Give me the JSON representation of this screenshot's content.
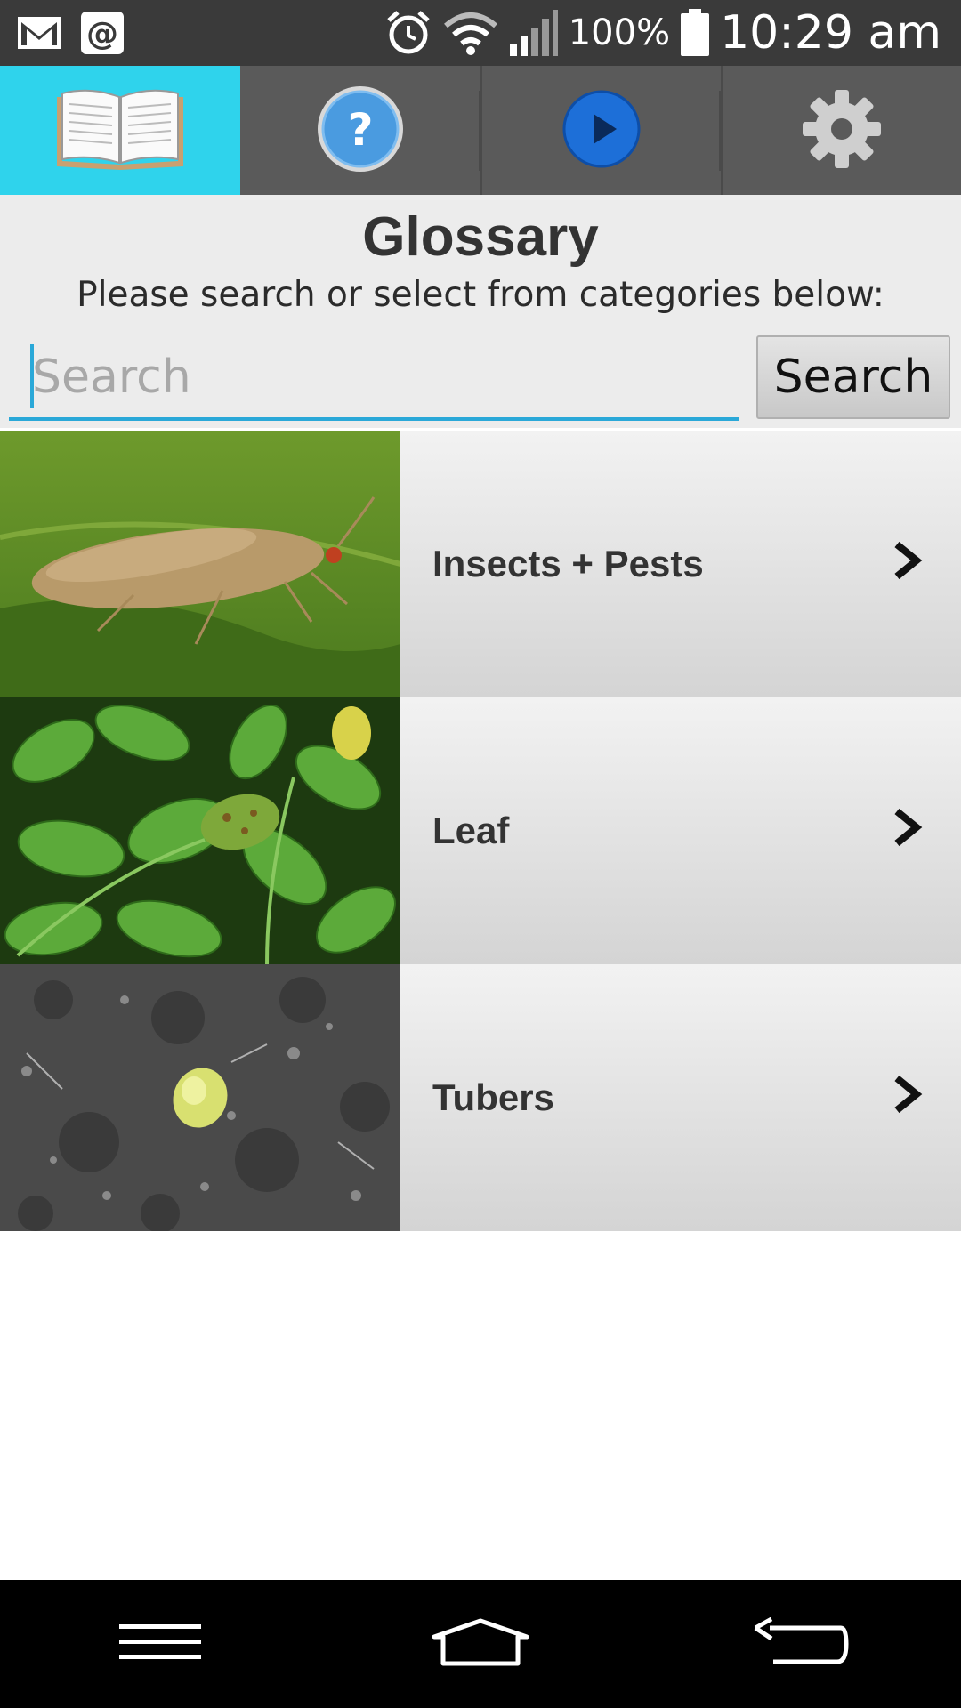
{
  "status_bar": {
    "battery": "100%",
    "time": "10:29 am",
    "icons": [
      "gmail-icon",
      "email-at-icon",
      "alarm-icon",
      "wifi-icon",
      "signal-icon",
      "battery-icon"
    ]
  },
  "tabs": [
    {
      "name": "glossary",
      "icon": "book-icon",
      "active": true
    },
    {
      "name": "help",
      "icon": "help-icon",
      "active": false
    },
    {
      "name": "video",
      "icon": "play-icon",
      "active": false
    },
    {
      "name": "settings",
      "icon": "gear-icon",
      "active": false
    }
  ],
  "header": {
    "title": "Glossary",
    "subtitle": "Please search or select from categories below:"
  },
  "search": {
    "placeholder": "Search",
    "value": "",
    "button_label": "Search"
  },
  "categories": [
    {
      "label": "Insects + Pests",
      "image": "moth-on-leaf"
    },
    {
      "label": "Leaf",
      "image": "potato-leaves"
    },
    {
      "label": "Tubers",
      "image": "tuber-in-soil"
    }
  ],
  "nav_bar": {
    "icons": [
      "menu-icon",
      "home-icon",
      "back-icon"
    ]
  },
  "colors": {
    "accent": "#2fd3ec",
    "tab_bar": "#5a5a5a",
    "search_underline": "#2aa8d8"
  }
}
